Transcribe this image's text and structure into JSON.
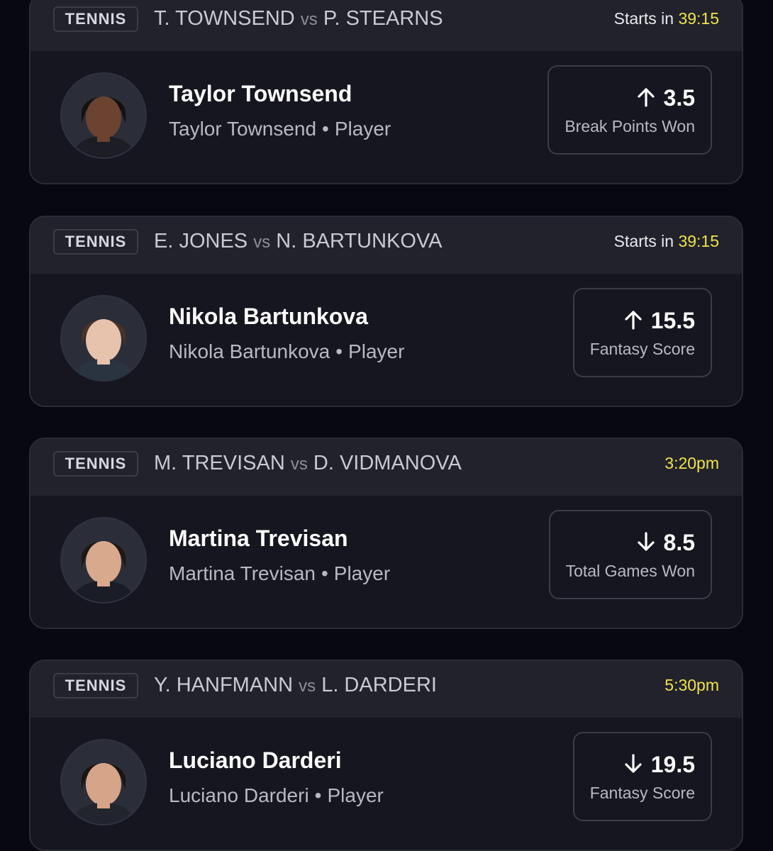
{
  "cards": [
    {
      "sport": "TENNIS",
      "team_a": "T. TOWNSEND",
      "vs": "vs",
      "team_b": "P. STEARNS",
      "time_prefix": "Starts in ",
      "time_value": "39:15",
      "player_name": "Taylor Townsend",
      "player_team": "Taylor Townsend",
      "player_role": "Player",
      "direction": "up",
      "line": "3.5",
      "stat": "Break Points Won",
      "avatar_skin": "#6b4330",
      "avatar_hair": "#141010",
      "avatar_shirt": "#1d1d26"
    },
    {
      "sport": "TENNIS",
      "team_a": "E. JONES",
      "vs": "vs",
      "team_b": "N. BARTUNKOVA",
      "time_prefix": "Starts in ",
      "time_value": "39:15",
      "player_name": "Nikola Bartunkova",
      "player_team": "Nikola Bartunkova",
      "player_role": "Player",
      "direction": "up",
      "line": "15.5",
      "stat": "Fantasy Score",
      "avatar_skin": "#e7c2ad",
      "avatar_hair": "#4a3328",
      "avatar_shirt": "#2a3340"
    },
    {
      "sport": "TENNIS",
      "team_a": "M. TREVISAN",
      "vs": "vs",
      "team_b": "D. VIDMANOVA",
      "time_prefix": "",
      "time_value": "3:20pm",
      "player_name": "Martina Trevisan",
      "player_team": "Martina Trevisan",
      "player_role": "Player",
      "direction": "down",
      "line": "8.5",
      "stat": "Total Games Won",
      "avatar_skin": "#d9a98e",
      "avatar_hair": "#1f1612",
      "avatar_shirt": "#1a1c26"
    },
    {
      "sport": "TENNIS",
      "team_a": "Y. HANFMANN",
      "vs": "vs",
      "team_b": "L. DARDERI",
      "time_prefix": "",
      "time_value": "5:30pm",
      "player_name": "Luciano Darderi",
      "player_team": "Luciano Darderi",
      "player_role": "Player",
      "direction": "down",
      "line": "19.5",
      "stat": "Fantasy Score",
      "avatar_skin": "#d6a488",
      "avatar_hair": "#1a1512",
      "avatar_shirt": "#22252e"
    }
  ],
  "colors": {
    "background": "#070810",
    "card": "#15161f",
    "header": "#21222b",
    "countdown": "#f2e24a",
    "muted_text": "#b8b9c1"
  }
}
